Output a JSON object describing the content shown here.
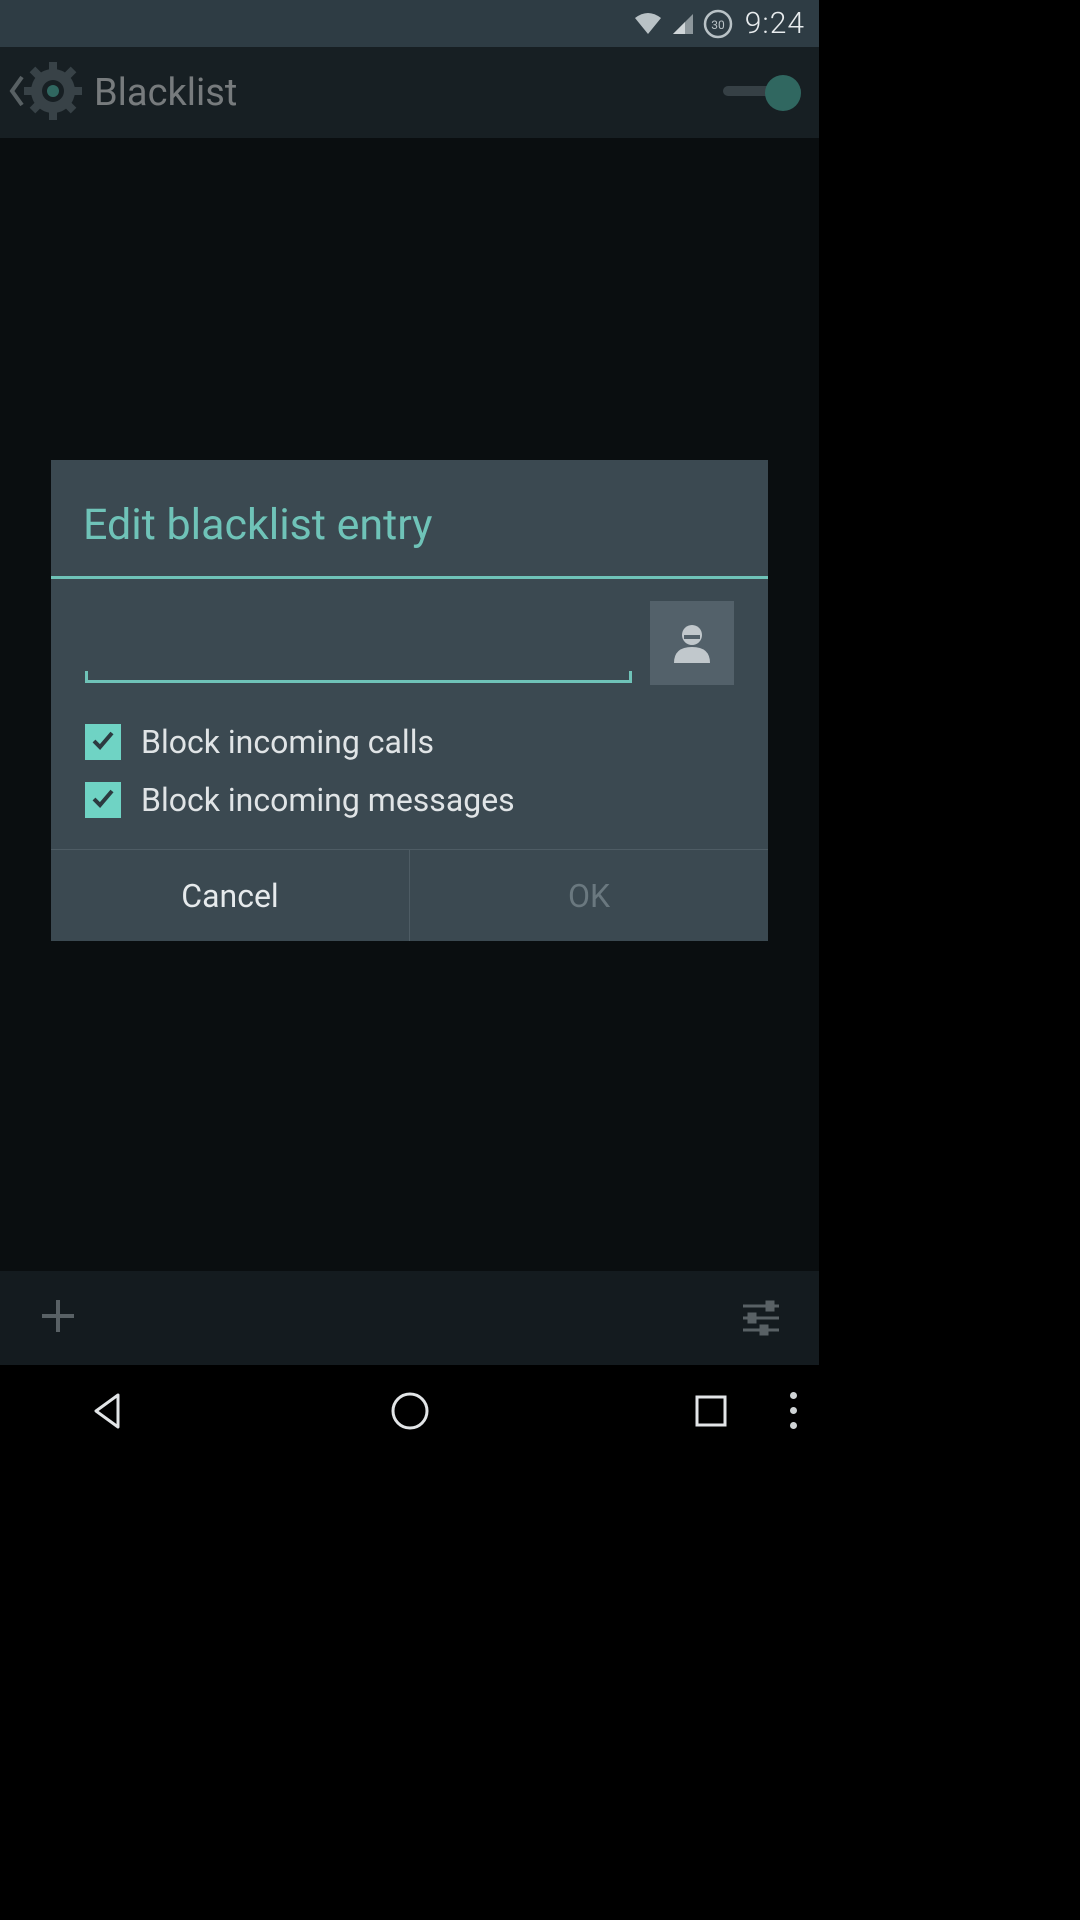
{
  "status": {
    "time": "9:24",
    "alarm_badge": "30"
  },
  "appbar": {
    "title": "Blacklist",
    "toggle_on": true
  },
  "dialog": {
    "title": "Edit blacklist entry",
    "input_value": "",
    "check_calls": {
      "label": "Block incoming calls",
      "checked": true
    },
    "check_messages": {
      "label": "Block incoming messages",
      "checked": true
    },
    "cancel_label": "Cancel",
    "ok_label": "OK"
  },
  "colors": {
    "accent": "#6fc3b8",
    "dialog_bg": "#3b4951"
  }
}
